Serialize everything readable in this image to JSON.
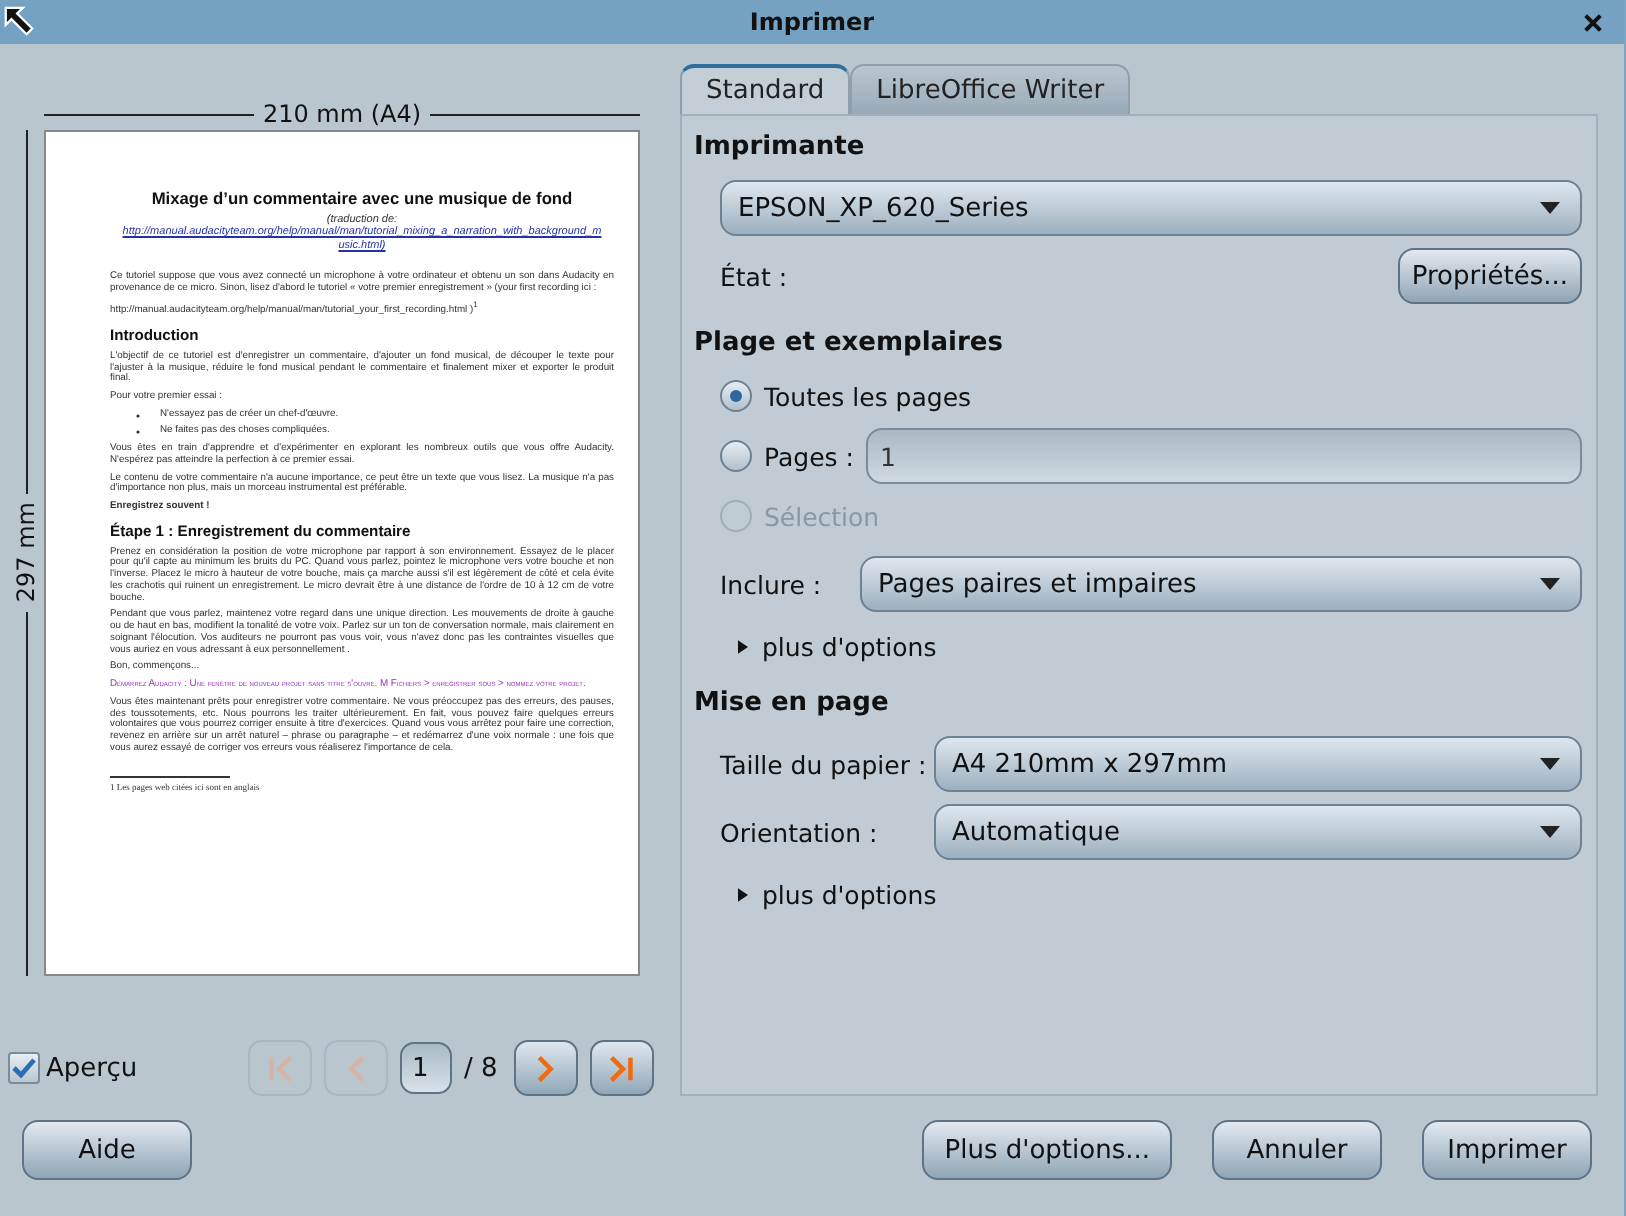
{
  "window": {
    "title": "Imprimer"
  },
  "preview": {
    "width_label": "210 mm (A4)",
    "height_label": "297 mm",
    "blocks": [
      {
        "kind": "title",
        "text": "Mixage d’un commentaire avec une musique de fond"
      },
      {
        "kind": "subtitle",
        "text": "(traduction de:"
      },
      {
        "kind": "link",
        "text": "http://manual.audacityteam.org/help/manual/man/tutorial_mixing_a_narration_with_background_music.html)"
      },
      {
        "kind": "para",
        "text": "Ce tutoriel suppose que vous avez connecté un microphone à votre ordinateur et obtenu un son dans Audacity en provenance de ce micro. Sinon, lisez d'abord le tutoriel « votre premier enregistrement » (your first recording ici :"
      },
      {
        "kind": "para",
        "text": "http://manual.audacityteam.org/help/manual/man/tutorial_your_first_recording.html  )$^{1}$"
      },
      {
        "kind": "heading",
        "text": "Introduction"
      },
      {
        "kind": "para",
        "text": "L'objectif de ce tutoriel est d'enregistrer un commentaire, d'ajouter un fond musical, de découper le texte pour l'ajuster à la musique, réduire le fond musical pendant le commentaire et finalement mixer et exporter le produit final."
      },
      {
        "kind": "para",
        "text": "Pour votre premier essai :"
      },
      {
        "kind": "bullet",
        "text": "N'essayez pas de créer un chef-d'œuvre."
      },
      {
        "kind": "bullet",
        "text": "Ne faites pas des choses compliquées."
      },
      {
        "kind": "para",
        "text": "Vous êtes en train d'apprendre et d'expérimenter en explorant les nombreux outils que vous offre Audacity. N'espérez pas atteindre la perfection à ce premier essai."
      },
      {
        "kind": "para",
        "text": "Le contenu de votre commentaire n'a aucune importance, ce peut être un texte que vous lisez. La musique n'a pas d'importance non plus, mais un morceau instrumental est préférable."
      },
      {
        "kind": "strong",
        "text": "Enregistrez souvent !"
      },
      {
        "kind": "heading",
        "text": "Étape 1 : Enregistrement du commentaire"
      },
      {
        "kind": "para",
        "text": "Prenez en considération la position de votre microphone par rapport à son environnement. Essayez de le placer pour qu'il capte au minimum les bruits du PC. Quand vous parlez, pointez le microphone vers votre bouche et non l'inverse. Placez le micro à hauteur de votre bouche, mais ça marche aussi s'il est légèrement de côté et cela évite les crachotis qui ruinent un enregistrement. Le micro devrait être à une distance de l'ordre de 10 à 12 cm de votre bouche."
      },
      {
        "kind": "para",
        "text": "Pendant que vous parlez, maintenez votre regard dans une unique direction. Les mouvements de droite à gauche ou de haut en bas, modifient la tonalité de votre voix. Parlez sur un ton de conversation normale, mais clairement en soignant l'élocution. Vos auditeurs ne pourront pas vous voir, vous n'avez donc pas les contraintes visuelles que vous auriez en vous adressant à eux personnellement ."
      },
      {
        "kind": "para",
        "text": "Bon, commençons..."
      },
      {
        "kind": "menu",
        "text": "Démarrez Audacity : Une fenêtre de nouveau projet sans titre s'ouvre. M Fichiers > enregistrer sous > nommez votre projet."
      },
      {
        "kind": "para",
        "text": "Vous êtes maintenant prêts pour enregistrer votre commentaire. Ne vous préoccupez pas des erreurs, des pauses, des toussotements, etc. Nous pourrons les traiter ultérieurement. En fait, vous pouvez faire quelques erreurs volontaires que vous pourrez corriger ensuite à titre d'exercices. Quand vous vous arrêtez pour faire une correction, revenez en arrière sur un arrêt naturel – phrase ou paragraphe – et redémarrez d'une voix normale : une fois que vous aurez essayé de corriger vos erreurs vous réaliserez l'importance de cela."
      },
      {
        "kind": "footnote",
        "text": "1   Les pages web citées ici sont en anglais"
      }
    ]
  },
  "preview_checkbox": {
    "label": "Aperçu",
    "checked": true
  },
  "pager": {
    "nav": [
      {
        "kind": "first",
        "disabled": true
      },
      {
        "kind": "prev",
        "disabled": true
      }
    ],
    "page": "1",
    "total": "/ 8",
    "nav_after": [
      {
        "kind": "next",
        "disabled": false
      },
      {
        "kind": "last",
        "disabled": false
      }
    ]
  },
  "tabs": [
    {
      "label": "Standard",
      "selected": true
    },
    {
      "label": "LibreOffice Writer",
      "selected": false
    }
  ],
  "printer": {
    "heading": "Imprimante",
    "name": "EPSON_XP_620_Series",
    "status_label": "État :",
    "properties_button": "Propriétés..."
  },
  "range": {
    "heading": "Plage et exemplaires",
    "options": [
      {
        "kind": "radio",
        "label": "Toutes les pages",
        "selected": true,
        "disabled": false
      },
      {
        "kind": "field",
        "label": "Pages :",
        "value": "1",
        "selected": false,
        "disabled": false
      },
      {
        "kind": "radio",
        "label": "Sélection",
        "selected": false,
        "disabled": true
      }
    ],
    "include": {
      "label": "Inclure :",
      "value": "Pages paires et impaires"
    },
    "more": {
      "label": "plus d'options",
      "expanded": false
    }
  },
  "layout": {
    "heading": "Mise en page",
    "fields": [
      {
        "label": "Taille du papier :",
        "value": "A4 210mm x 297mm"
      },
      {
        "label": "Orientation :",
        "value": "Automatique"
      }
    ],
    "more": {
      "label": "plus d'options",
      "expanded": false
    }
  },
  "buttons": [
    {
      "label": "Aide",
      "kind": "left"
    },
    {
      "label": "Plus d'options...",
      "kind": "right"
    },
    {
      "label": "Annuler",
      "kind": "right"
    },
    {
      "label": "Imprimer",
      "kind": "right"
    }
  ]
}
